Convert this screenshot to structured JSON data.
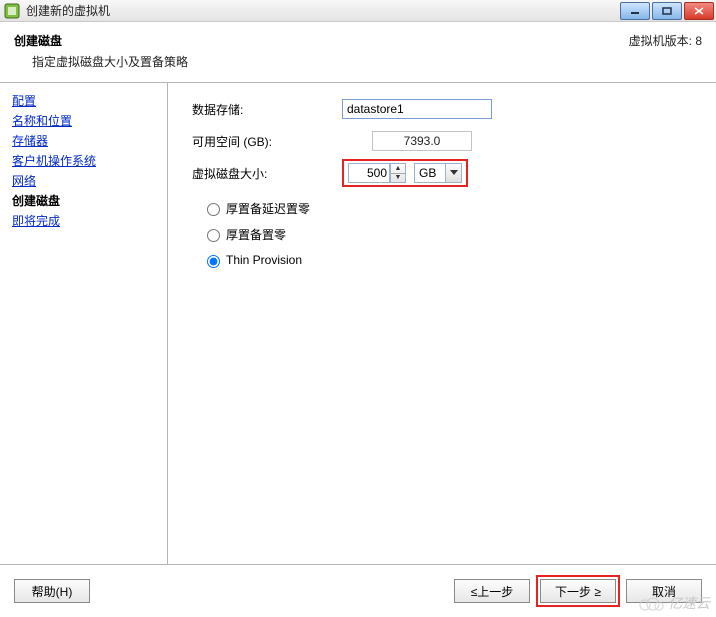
{
  "window": {
    "title": "创建新的虚拟机",
    "minimize": "_",
    "maximize": "□",
    "close": "×"
  },
  "header": {
    "title": "创建磁盘",
    "subtitle": "指定虚拟磁盘大小及置备策略",
    "vm_version": "虚拟机版本: 8"
  },
  "nav": {
    "items": [
      {
        "label": "配置",
        "active": false
      },
      {
        "label": "名称和位置",
        "active": false
      },
      {
        "label": "存储器",
        "active": false
      },
      {
        "label": "客户机操作系统",
        "active": false
      },
      {
        "label": "网络",
        "active": false
      },
      {
        "label": "创建磁盘",
        "active": true
      },
      {
        "label": "即将完成",
        "active": false
      }
    ]
  },
  "form": {
    "datastore_label": "数据存储:",
    "datastore_value": "datastore1",
    "freespace_label": "可用空间 (GB):",
    "freespace_value": "7393.0",
    "disksize_label": "虚拟磁盘大小:",
    "disksize_value": "500",
    "disksize_unit": "GB",
    "provisioning": {
      "opt1": "厚置备延迟置零",
      "opt2": "厚置备置零",
      "opt3": "Thin Provision",
      "selected": 2
    }
  },
  "footer": {
    "help": "帮助(H)",
    "back": "≤上一步",
    "next": "下一步 ≥",
    "cancel": "取消"
  },
  "watermark": "亿速云"
}
